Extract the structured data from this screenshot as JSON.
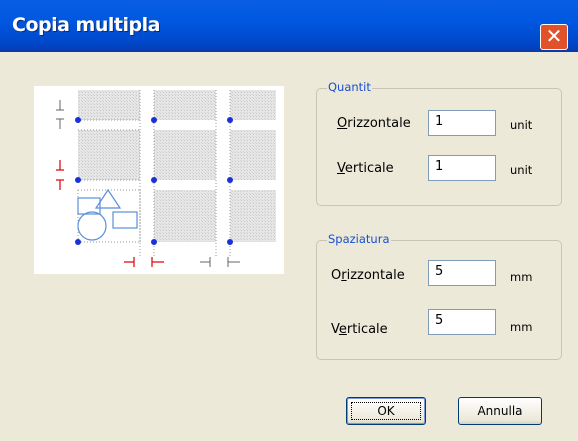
{
  "window": {
    "title": "Copia multipla",
    "close_label": "✕"
  },
  "quantity": {
    "legend": "Quantit",
    "horizontal": {
      "label_underline": "O",
      "label_rest": "rizzontale",
      "value": "1",
      "unit": "unit"
    },
    "vertical": {
      "label_underline": "V",
      "label_rest": "erticale",
      "value": "1",
      "unit": "unit"
    }
  },
  "spacing": {
    "legend": "Spaziatura",
    "horizontal": {
      "label_pre": "O",
      "label_underline": "r",
      "label_rest": "izzontale",
      "value": "5",
      "unit": "mm"
    },
    "vertical": {
      "label_pre": "V",
      "label_underline": "e",
      "label_rest": "rticale",
      "value": "5",
      "unit": "mm"
    }
  },
  "buttons": {
    "ok": "OK",
    "cancel": "Annulla"
  },
  "colors": {
    "accent_blue": "#1a4fd0",
    "marker_red": "#e01010",
    "title_bar": "#0058e0"
  },
  "icons": {
    "close": "close-icon"
  }
}
